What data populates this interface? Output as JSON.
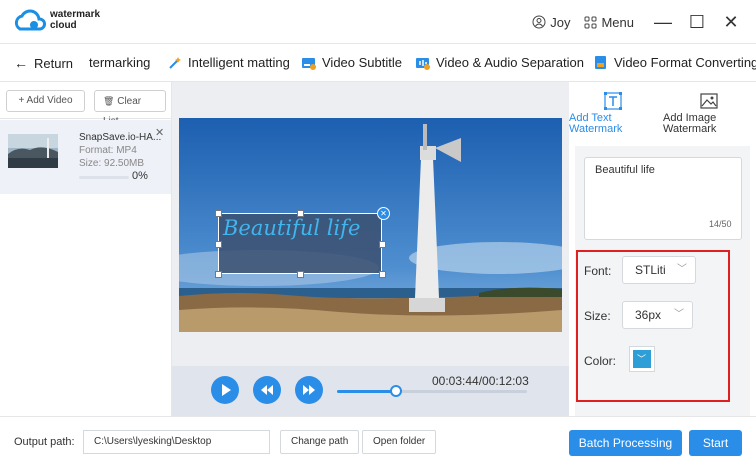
{
  "app": {
    "brand_line1": "watermark",
    "brand_line2": "cloud"
  },
  "window": {
    "user": "Joy",
    "menu_label": "Menu",
    "minimize_glyph": "—",
    "maximize_glyph": "☐",
    "close_glyph": "✕"
  },
  "toolbar": {
    "return_label": "Return",
    "mode_label": "termarking",
    "items": [
      "Intelligent matting",
      "Video Subtitle",
      "Video & Audio Separation",
      "Video Format Converting"
    ]
  },
  "left": {
    "add_video": "+ Add Video",
    "clear_list": "Clear List",
    "file": {
      "name": "SnapSave.io-HA...",
      "format": "Format:  MP4",
      "size": "Size:  92.50MB",
      "progress_pct": "0%",
      "progress": 0
    }
  },
  "video": {
    "watermark_text": "Beautiful life"
  },
  "player": {
    "time": "00:03:44/00:12:03",
    "position": 0.31
  },
  "right": {
    "tab_text": "Add Text Watermark",
    "tab_image": "Add Image Watermark",
    "text_value": "Beautiful life",
    "counter": "14/50",
    "font_label": "Font:",
    "font_value": "STLiti",
    "size_label": "Size:",
    "size_value": "36px",
    "color_label": "Color:",
    "color_value": "#2e9fd6"
  },
  "bottom": {
    "output_label": "Output path:",
    "output_path": "C:\\Users\\lyesking\\Desktop",
    "change_path": "Change path",
    "open_folder": "Open folder",
    "batch": "Batch Processing",
    "start": "Start"
  },
  "colors": {
    "accent": "#2a8ee9",
    "highlight": "#e02020"
  }
}
